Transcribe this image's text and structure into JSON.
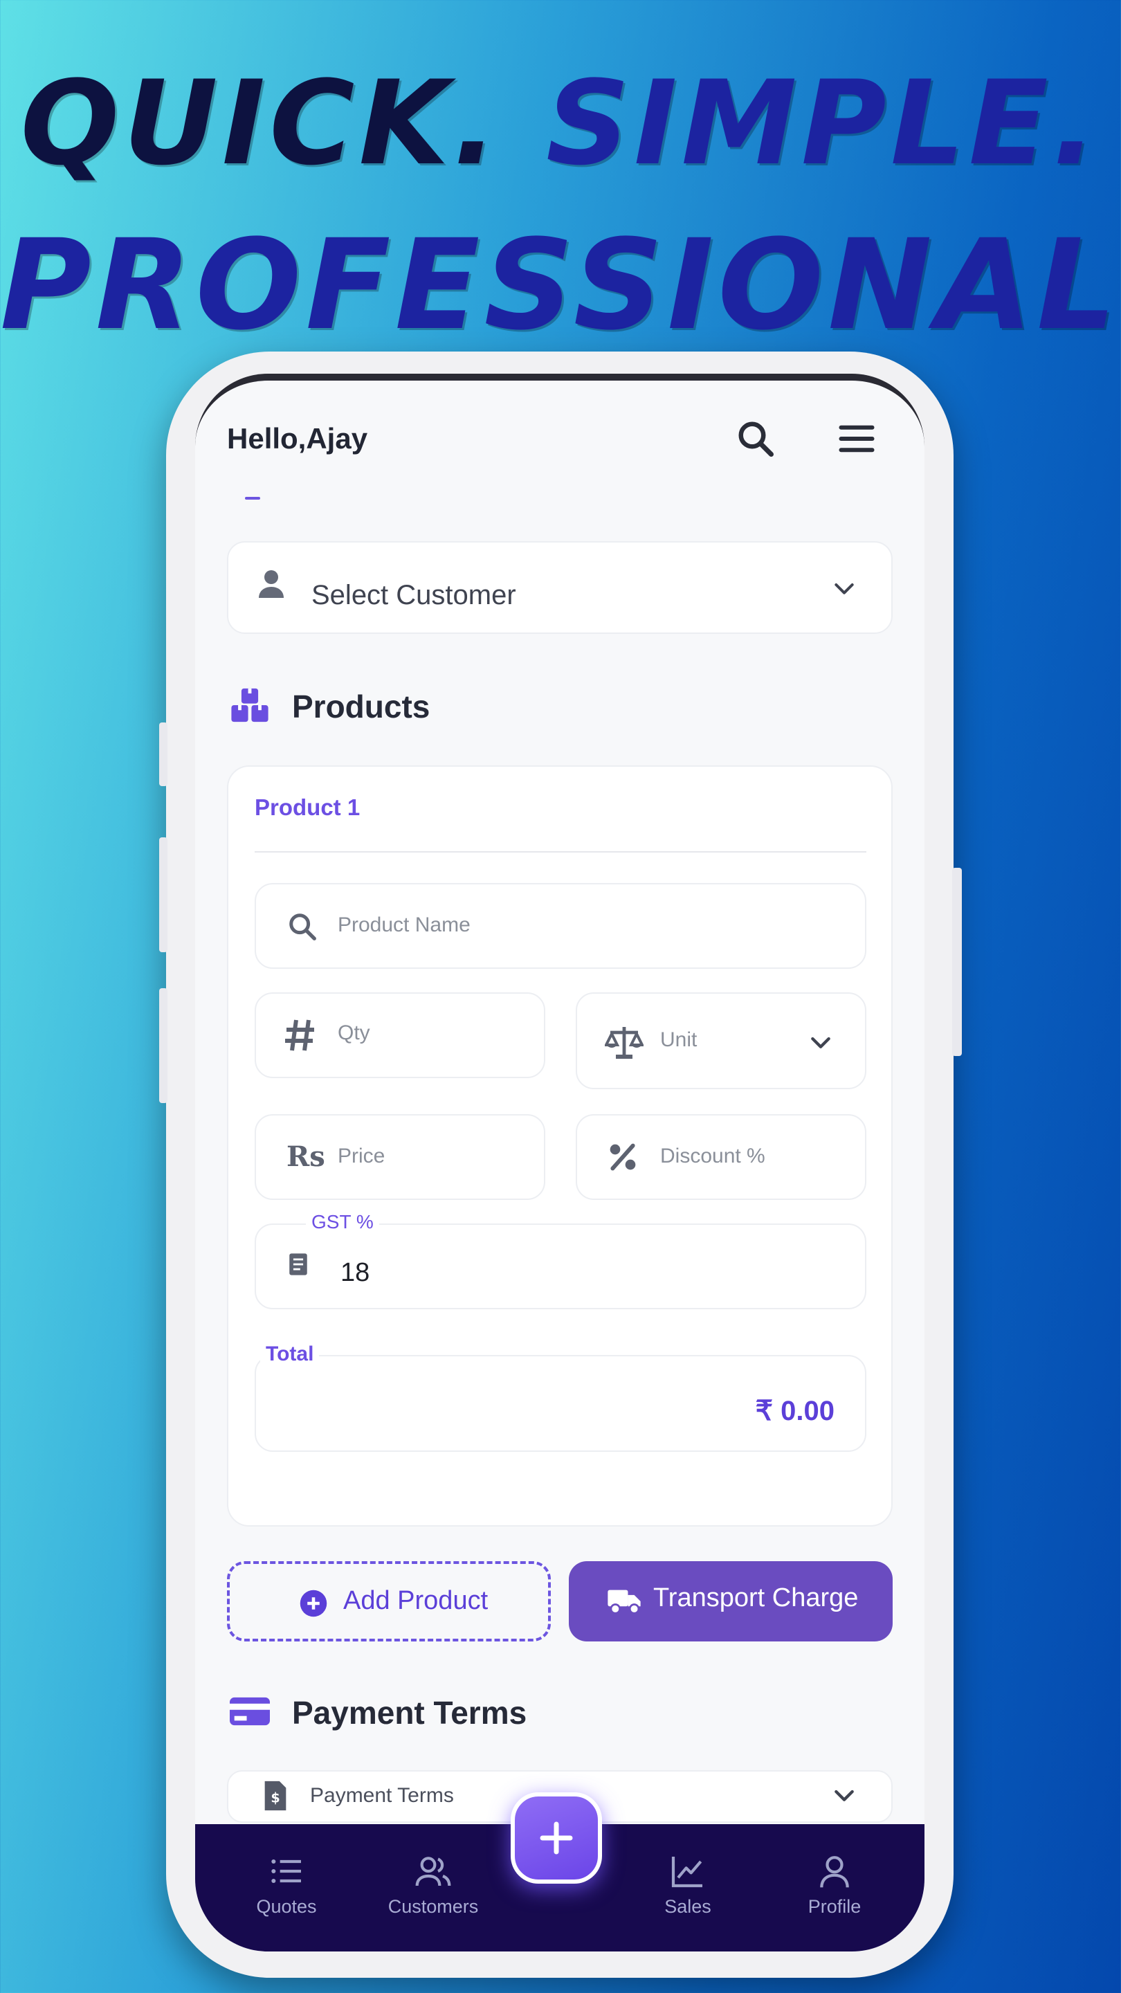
{
  "headline": {
    "line1a": "QUICK.",
    "line1b": "SIMPLE.",
    "line2": "PROFESSIONAL."
  },
  "header": {
    "greeting": "Hello,Ajay"
  },
  "customer": {
    "placeholder": "Select Customer"
  },
  "products": {
    "section_title": "Products",
    "items": [
      {
        "label": "Product 1",
        "name_placeholder": "Product Name",
        "qty_placeholder": "Qty",
        "unit_placeholder": "Unit",
        "price_placeholder": "Price",
        "discount_placeholder": "Discount %",
        "gst_label": "GST %",
        "gst_value": "18",
        "total_label": "Total",
        "total_value": "₹ 0.00"
      }
    ]
  },
  "actions": {
    "add_product": "Add Product",
    "transport_charge": "Transport Charge"
  },
  "payment": {
    "section_title": "Payment Terms",
    "select_label": "Payment Terms"
  },
  "nav": {
    "items": [
      {
        "label": "Quotes",
        "icon": "list-icon"
      },
      {
        "label": "Customers",
        "icon": "users-icon"
      },
      {
        "label": "Sales",
        "icon": "chart-icon"
      },
      {
        "label": "Profile",
        "icon": "user-icon"
      }
    ],
    "fab_icon": "plus-icon"
  },
  "colors": {
    "accent": "#6c4fe3",
    "nav_bg": "#170a4e",
    "transport_btn": "#6a4cc0",
    "screen_bg": "#f7f8fa"
  }
}
